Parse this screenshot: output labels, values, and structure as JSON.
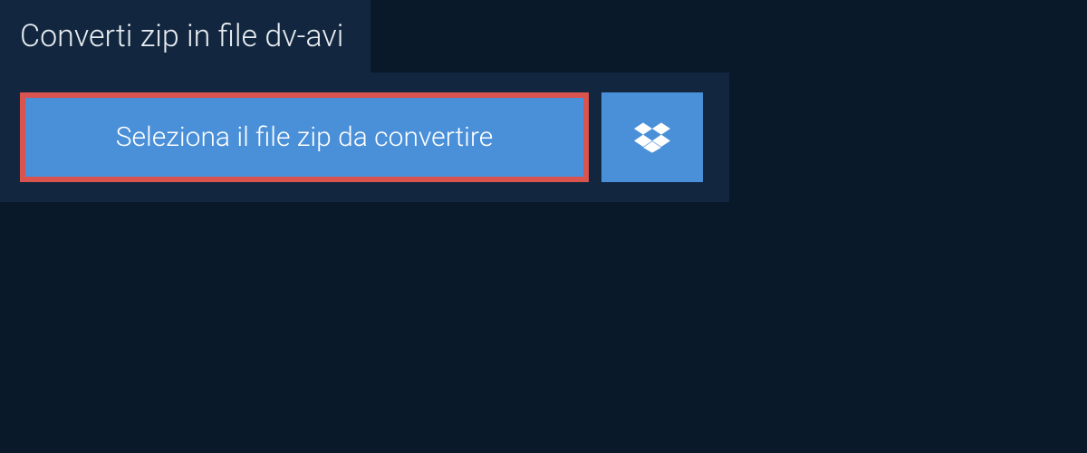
{
  "header": {
    "title": "Converti zip in file dv-avi"
  },
  "actions": {
    "select_file_label": "Seleziona il file zip da convertire"
  },
  "colors": {
    "background": "#0a1929",
    "panel": "#12273f",
    "button": "#4a90d9",
    "highlight_border": "#d9534f",
    "text_light": "#e8edf2",
    "text_white": "#ffffff"
  }
}
